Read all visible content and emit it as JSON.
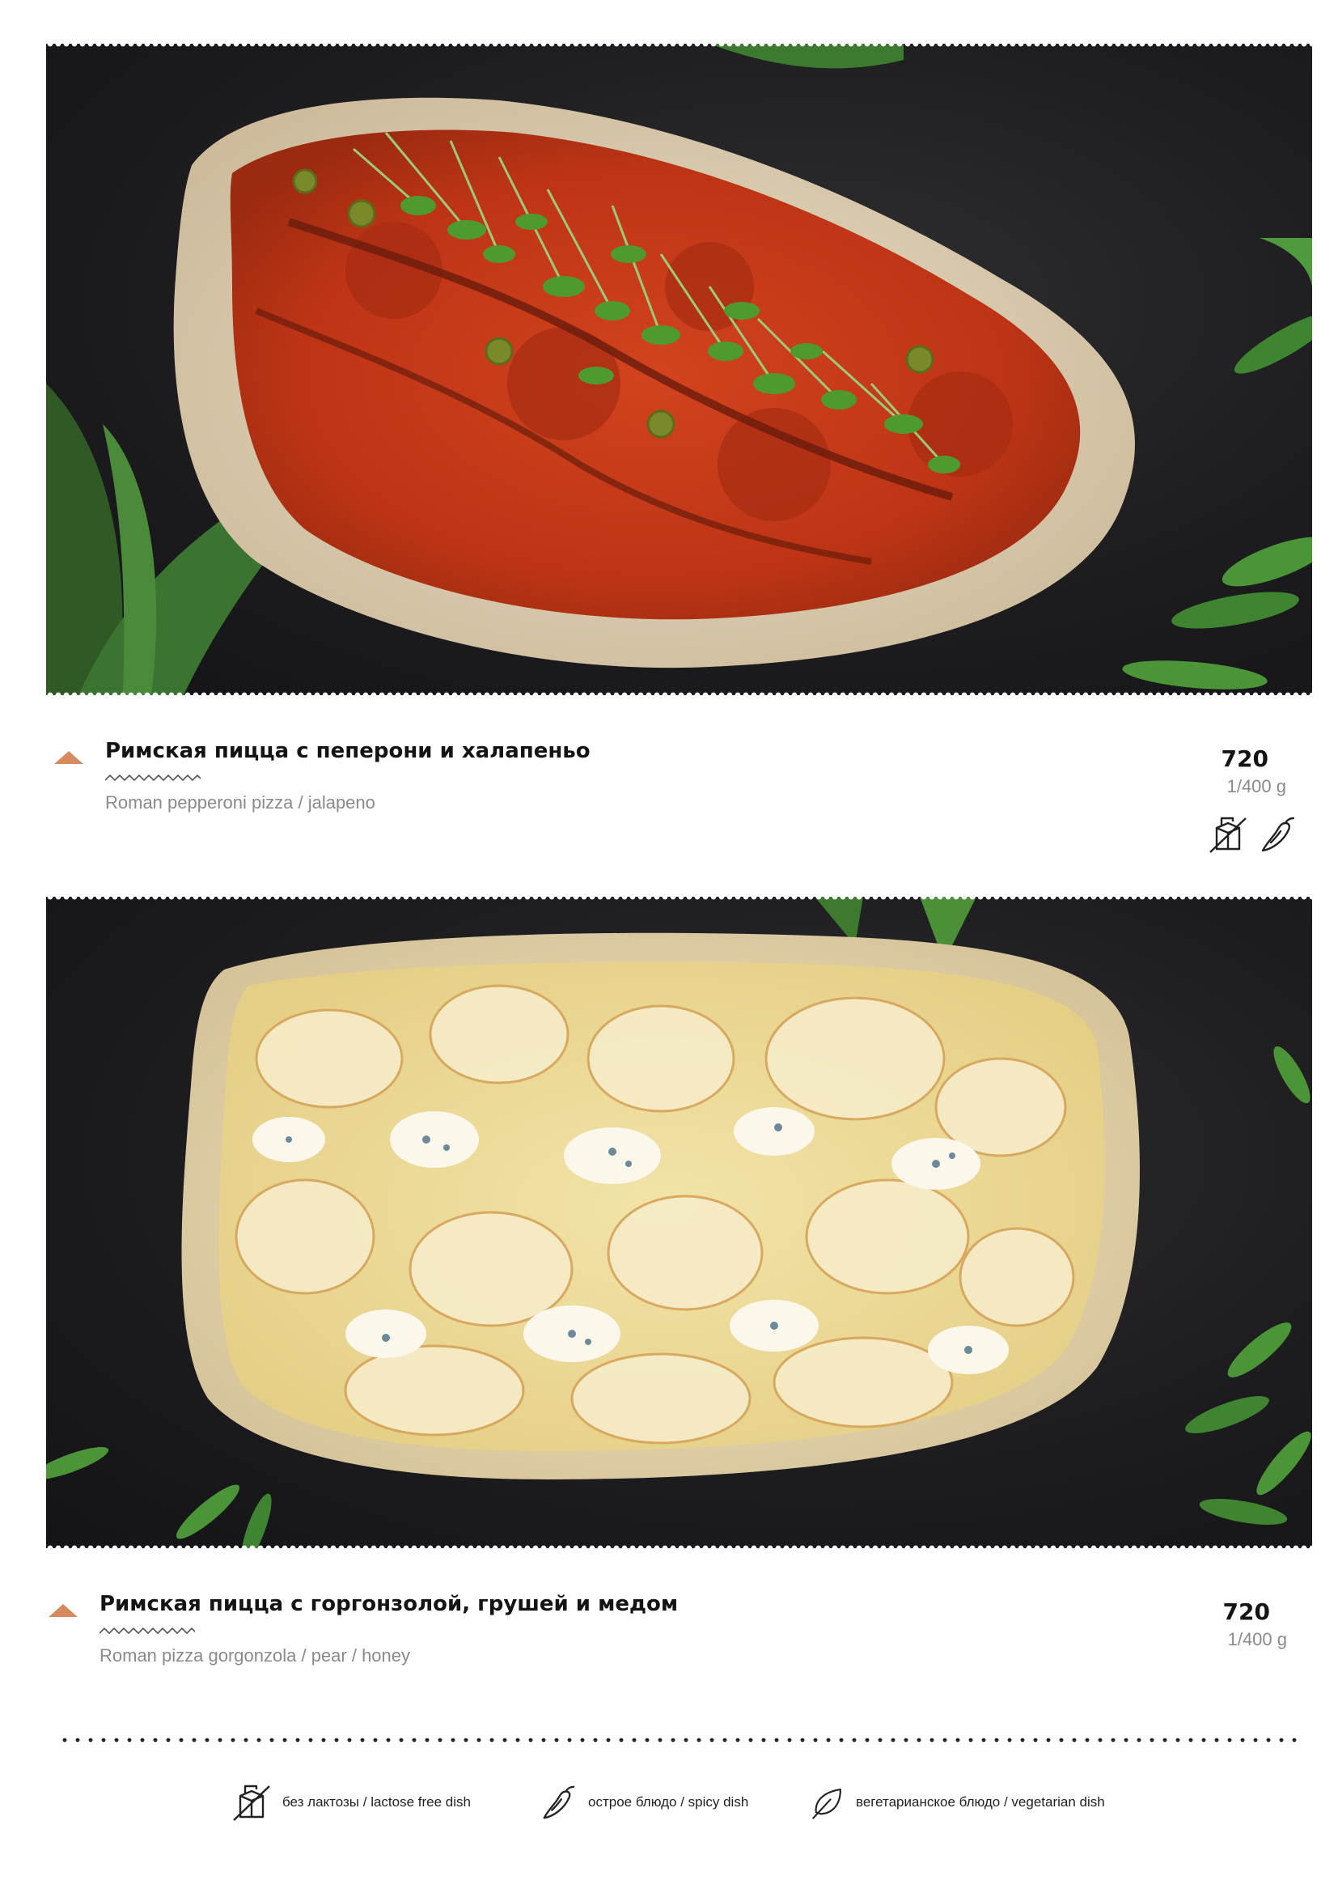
{
  "menu_items": [
    {
      "name_ru": "Римская пицца с пеперони и халапеньо",
      "name_en": "Roman pepperoni pizza / jalapeno",
      "price": "720",
      "weight": "1/400 g",
      "badges": [
        "lactose-free-icon",
        "spicy-icon"
      ]
    },
    {
      "name_ru": "Римская пицца с горгонзолой, грушей и медом",
      "name_en": "Roman pizza gorgonzola / pear / honey",
      "price": "720",
      "weight": "1/400 g",
      "badges": []
    }
  ],
  "legend": {
    "lactose_free": "без лактозы / lactose free dish",
    "spicy": "острое блюдо / spicy dish",
    "vegetarian": "вегетарианское блюдо / vegetarian dish"
  },
  "colors": {
    "accent": "#d58b5e",
    "background_photo": "#1d1d1f",
    "text": "#141414",
    "muted": "#8a8a8a"
  }
}
